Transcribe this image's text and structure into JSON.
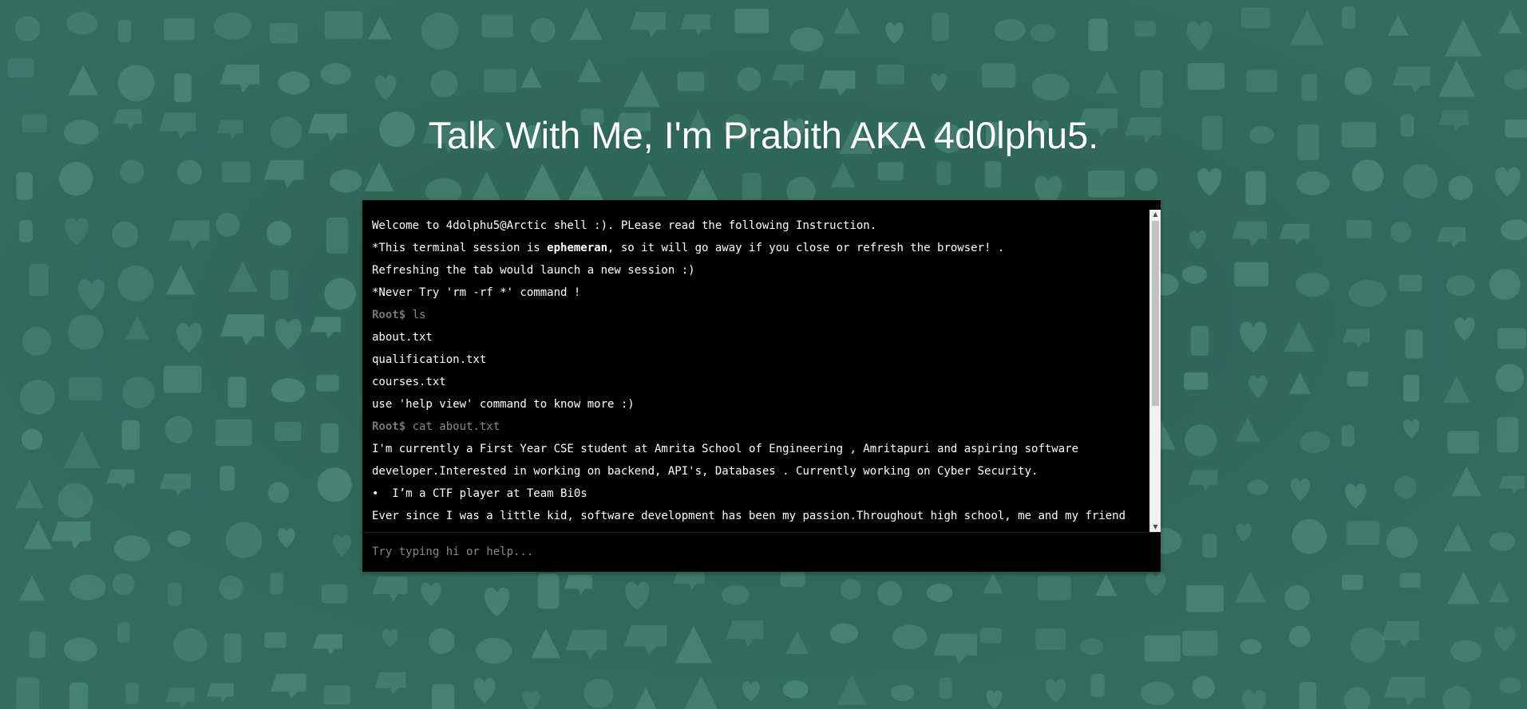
{
  "page": {
    "title": "Talk With Me, I'm Prabith AKA 4d0lphu5."
  },
  "colors": {
    "background": "#2f6b5c",
    "background_icons": "#4d8a79",
    "terminal_bg": "#000000",
    "terminal_text": "#ffffff",
    "prompt": "#777777"
  },
  "terminal": {
    "lines": [
      {
        "type": "text",
        "text": "Welcome to 4dolphu5@Arctic shell :). PLease read the following Instruction."
      },
      {
        "type": "rich",
        "before": "*This terminal session is ",
        "bold": "ephemeran",
        "after": ", so it will go away if you close or refresh the browser! ."
      },
      {
        "type": "text",
        "text": "Refreshing the tab would launch a new session :)"
      },
      {
        "type": "text",
        "text": "*Never Try 'rm -rf *' command !"
      },
      {
        "type": "prompt",
        "prompt": "Root$",
        "command": " ls"
      },
      {
        "type": "text",
        "text": "about.txt"
      },
      {
        "type": "text",
        "text": "qualification.txt"
      },
      {
        "type": "text",
        "text": "courses.txt"
      },
      {
        "type": "text",
        "text": "use 'help view' command to know more :)"
      },
      {
        "type": "prompt",
        "prompt": "Root$",
        "command": " cat about.txt"
      },
      {
        "type": "text",
        "text": "I'm currently a First Year CSE student at Amrita School of Engineering , Amritapuri and aspiring software"
      },
      {
        "type": "text",
        "text": "developer.Interested in working on backend, API's, Databases . Currently working on Cyber Security."
      },
      {
        "type": "bullet",
        "bullet": "•",
        "text": "  I’m a CTF player at Team Bi0s"
      },
      {
        "type": "text",
        "text": "Ever since I was a little kid, software development has been my passion.Throughout high school, me and my friend"
      }
    ],
    "input_placeholder": "Try typing hi or help...",
    "scroll_up_icon": "triangle-up",
    "scroll_down_icon": "triangle-down"
  }
}
